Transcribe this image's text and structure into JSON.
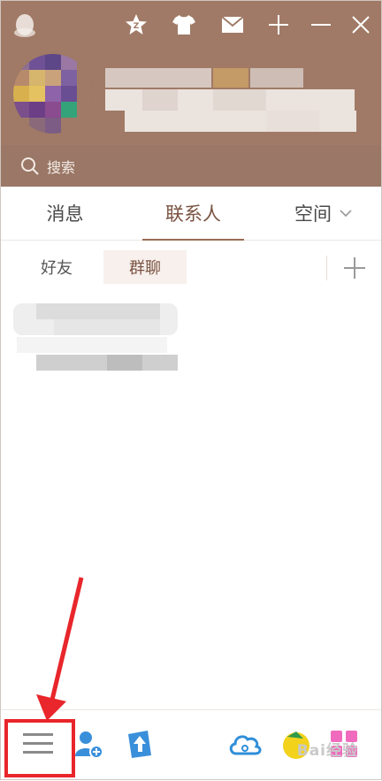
{
  "search": {
    "placeholder": "搜索"
  },
  "tabs": [
    {
      "label": "消息"
    },
    {
      "label": "联系人"
    },
    {
      "label": "空间"
    }
  ],
  "subtabs": [
    {
      "label": "好友"
    },
    {
      "label": "群聊"
    }
  ],
  "watermark": "Bai经验",
  "colors": {
    "header": "#a07a66",
    "accent": "#9a6b55",
    "annotation": "#e8262b"
  }
}
